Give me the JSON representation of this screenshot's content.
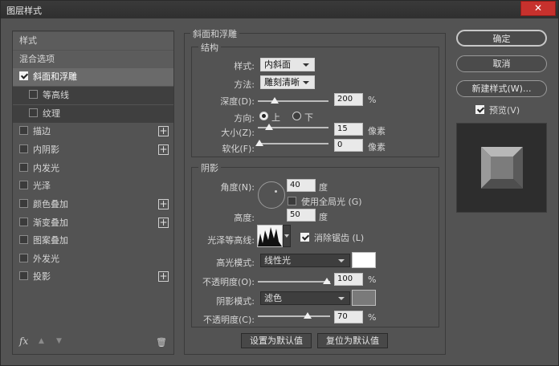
{
  "window": {
    "title": "图层样式",
    "close": "✕"
  },
  "left": {
    "styles_header": "样式",
    "blend_options": "混合选项",
    "items": [
      {
        "label": "斜面和浮雕",
        "checked": true
      },
      {
        "label": "等高线",
        "checked": false
      },
      {
        "label": "纹理",
        "checked": false
      },
      {
        "label": "描边",
        "checked": false,
        "plus": "+"
      },
      {
        "label": "内阴影",
        "checked": false,
        "plus": "+"
      },
      {
        "label": "内发光",
        "checked": false
      },
      {
        "label": "光泽",
        "checked": false
      },
      {
        "label": "颜色叠加",
        "checked": false,
        "plus": "+"
      },
      {
        "label": "渐变叠加",
        "checked": false,
        "plus": "+"
      },
      {
        "label": "图案叠加",
        "checked": false
      },
      {
        "label": "外发光",
        "checked": false
      },
      {
        "label": "投影",
        "checked": false,
        "plus": "+"
      }
    ],
    "footer": {
      "fx": "fx",
      "up": "▲",
      "down": "▼",
      "trash": "🗑"
    }
  },
  "bevel": {
    "title": "斜面和浮雕",
    "structure": {
      "title": "结构",
      "style_label": "样式:",
      "style_value": "内斜面",
      "technique_label": "方法:",
      "technique_value": "雕刻清晰",
      "depth_label": "深度(D):",
      "depth_value": "200",
      "depth_unit": "%",
      "direction_label": "方向:",
      "dir_up": "上",
      "dir_down": "下",
      "size_label": "大小(Z):",
      "size_value": "15",
      "size_unit": "像素",
      "soften_label": "软化(F):",
      "soften_value": "0",
      "soften_unit": "像素"
    },
    "shading": {
      "title": "阴影",
      "angle_label": "角度(N):",
      "angle_value": "40",
      "angle_unit": "度",
      "global_light": "使用全局光 (G)",
      "altitude_label": "高度:",
      "altitude_value": "50",
      "altitude_unit": "度",
      "gloss_label": "光泽等高线:",
      "antialias": "消除锯齿 (L)",
      "highlight_label": "高光模式:",
      "highlight_mode": "线性光",
      "highlight_color": "#ffffff",
      "hl_opacity_label": "不透明度(O):",
      "hl_opacity_value": "100",
      "hl_opacity_unit": "%",
      "shadow_label": "阴影模式:",
      "shadow_mode": "滤色",
      "shadow_color": "#7a7a7a",
      "sh_opacity_label": "不透明度(C):",
      "sh_opacity_value": "70",
      "sh_opacity_unit": "%"
    },
    "make_default": "设置为默认值",
    "reset_default": "复位为默认值"
  },
  "right": {
    "ok": "确定",
    "cancel": "取消",
    "new_style": "新建样式(W)...",
    "preview": "预览(V)"
  }
}
